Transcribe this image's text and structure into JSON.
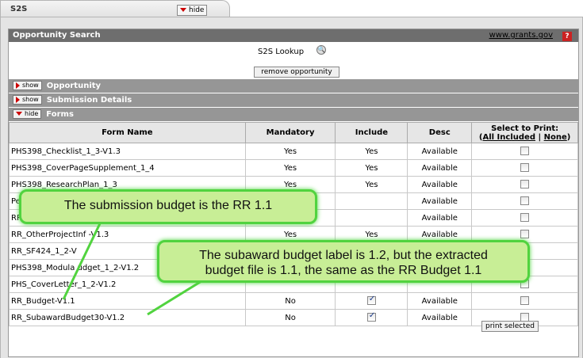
{
  "tab": {
    "title": "S2S",
    "hide_label": "hide"
  },
  "opportunity_search": {
    "title": "Opportunity Search",
    "grants_link": "www.grants.gov",
    "help": "?",
    "lookup_label": "S2S Lookup",
    "remove_button": "remove opportunity"
  },
  "subsections": [
    {
      "button": "show",
      "label": "Opportunity"
    },
    {
      "button": "show",
      "label": "Submission Details"
    },
    {
      "button": "hide",
      "label": "Forms"
    }
  ],
  "forms_table": {
    "headers": {
      "name": "Form Name",
      "mandatory": "Mandatory",
      "include": "Include",
      "desc": "Desc",
      "print_title": "Select to Print:",
      "all_included": "All Included",
      "separator": "|",
      "none": "None"
    },
    "rows": [
      {
        "name": "PHS398_Checklist_1_3-V1.3",
        "mandatory": "Yes",
        "include": "Yes",
        "desc": "Available"
      },
      {
        "name": "PHS398_CoverPageSupplement_1_4",
        "mandatory": "Yes",
        "include": "Yes",
        "desc": "Available"
      },
      {
        "name": "PHS398_ResearchPlan_1_3",
        "mandatory": "Yes",
        "include": "Yes",
        "desc": "Available"
      },
      {
        "name": "Pe",
        "mandatory": "",
        "include": "",
        "desc": "Available"
      },
      {
        "name": "RR",
        "mandatory": "",
        "include": "",
        "desc": "Available"
      },
      {
        "name": "RR_OtherProjectInf           -V1.3",
        "mandatory": "Yes",
        "include": "Yes",
        "desc": "Available"
      },
      {
        "name": "RR_SF424_1_2-V",
        "mandatory": "",
        "include": "",
        "desc": ""
      },
      {
        "name": "PHS398_Modula        udget_1_2-V1.2",
        "mandatory": "",
        "include": "",
        "desc": ""
      },
      {
        "name": "PHS_CoverLetter_1_2-V1.2",
        "mandatory": "",
        "include": "",
        "desc": ""
      },
      {
        "name": "RR_Budget-V1.1",
        "mandatory": "No",
        "include": "checkbox",
        "desc": "Available"
      },
      {
        "name": "RR_SubawardBudget30-V1.2",
        "mandatory": "No",
        "include": "checkbox",
        "desc": "Available"
      }
    ],
    "print_button": "print selected"
  },
  "callouts": {
    "first": "The submission budget is the RR 1.1",
    "second_line1": "The subaward budget label is 1.2, but the extracted",
    "second_line2": "budget file is 1.1, the same as the RR Budget 1.1"
  },
  "colors": {
    "section_header": "#6e6e6e",
    "subsection_header": "#969696",
    "callout_fill": "#c8ee96",
    "callout_border": "#51d33f",
    "hide_arrow": "#cc0000"
  }
}
